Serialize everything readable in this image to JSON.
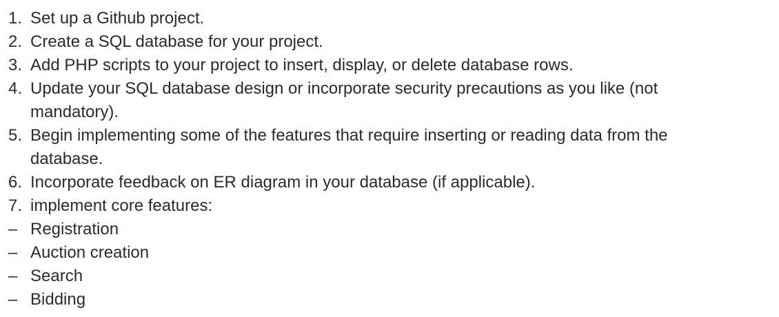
{
  "steps": [
    {
      "marker": "1.",
      "text": "Set up a Github project."
    },
    {
      "marker": "2.",
      "text": "Create a SQL database for your project."
    },
    {
      "marker": "3.",
      "text": "Add PHP scripts to your project to insert, display, or delete database rows."
    },
    {
      "marker": "4.",
      "text": "Update your SQL database design or incorporate security precautions as you like (not",
      "continuation": "mandatory)."
    },
    {
      "marker": "5.",
      "text": "Begin implementing some of the features that require inserting or reading data from the",
      "continuation": "database."
    },
    {
      "marker": "6.",
      "text": "Incorporate feedback on ER diagram in your database (if applicable)."
    },
    {
      "marker": "7.",
      "text": "implement core features:"
    }
  ],
  "features": [
    {
      "marker": "–",
      "text": "Registration"
    },
    {
      "marker": "–",
      "text": "Auction creation"
    },
    {
      "marker": "–",
      "text": "Search"
    },
    {
      "marker": "–",
      "text": "Bidding"
    }
  ]
}
